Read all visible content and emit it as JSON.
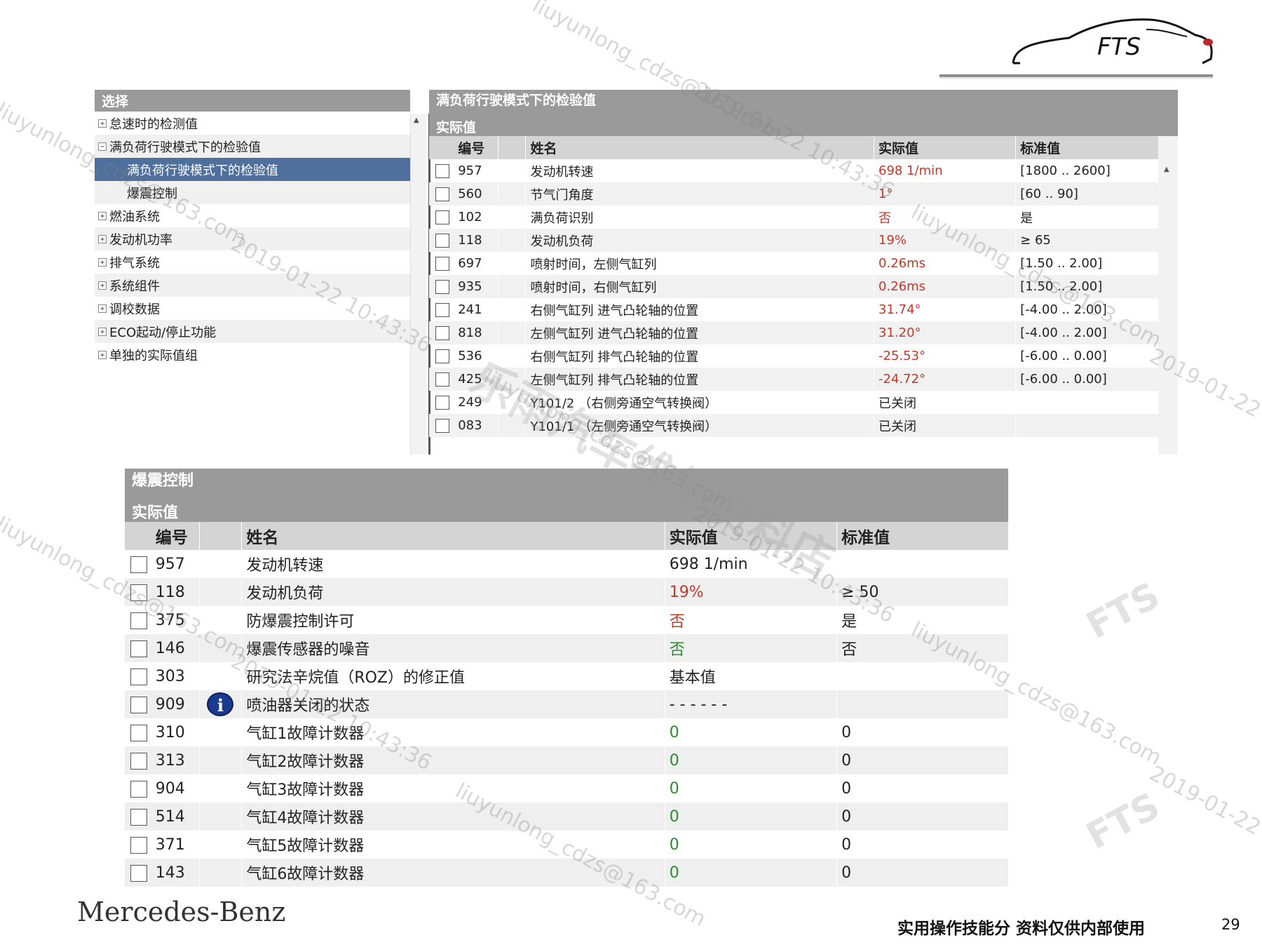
{
  "logo": {
    "text": "FTS"
  },
  "tree": {
    "header": "选择",
    "items": [
      {
        "label": "怠速时的检测值",
        "expander": "+",
        "level": 0,
        "selected": false
      },
      {
        "label": "满负荷行驶模式下的检验值",
        "expander": "−",
        "level": 0,
        "selected": false
      },
      {
        "label": "满负荷行驶模式下的检验值",
        "expander": "",
        "level": 1,
        "selected": true
      },
      {
        "label": "爆震控制",
        "expander": "",
        "level": 1,
        "selected": false
      },
      {
        "label": "燃油系统",
        "expander": "+",
        "level": 0,
        "selected": false
      },
      {
        "label": "发动机功率",
        "expander": "+",
        "level": 0,
        "selected": false
      },
      {
        "label": "排气系统",
        "expander": "+",
        "level": 0,
        "selected": false
      },
      {
        "label": "系统组件",
        "expander": "+",
        "level": 0,
        "selected": false
      },
      {
        "label": "调校数据",
        "expander": "+",
        "level": 0,
        "selected": false
      },
      {
        "label": "ECO起动/停止功能",
        "expander": "+",
        "level": 0,
        "selected": false
      },
      {
        "label": "单独的实际值组",
        "expander": "+",
        "level": 0,
        "selected": false
      }
    ]
  },
  "full_load": {
    "title": "满负荷行驶模式下的检验值",
    "subtitle": "实际值",
    "columns": {
      "num": "编号",
      "name": "姓名",
      "value": "实际值",
      "standard": "标准值"
    },
    "rows": [
      {
        "num": "957",
        "name": "发动机转速",
        "value": "698 1/min",
        "value_color": "red",
        "standard": "[1800 .. 2600]"
      },
      {
        "num": "560",
        "name": "节气门角度",
        "value": "1°",
        "value_color": "red",
        "standard": "[60 .. 90]"
      },
      {
        "num": "102",
        "name": "满负荷识别",
        "value": "否",
        "value_color": "red",
        "standard": "是"
      },
      {
        "num": "118",
        "name": "发动机负荷",
        "value": "19%",
        "value_color": "red",
        "standard": "≥ 65"
      },
      {
        "num": "697",
        "name": "喷射时间，左侧气缸列",
        "value": "0.26ms",
        "value_color": "red",
        "standard": "[1.50 .. 2.00]"
      },
      {
        "num": "935",
        "name": "喷射时间，右侧气缸列",
        "value": "0.26ms",
        "value_color": "red",
        "standard": "[1.50 .. 2.00]"
      },
      {
        "num": "241",
        "name": "右侧气缸列 进气凸轮轴的位置",
        "value": "31.74°",
        "value_color": "red",
        "standard": "[-4.00 .. 2.00]"
      },
      {
        "num": "818",
        "name": "左侧气缸列 进气凸轮轴的位置",
        "value": "31.20°",
        "value_color": "red",
        "standard": "[-4.00 .. 2.00]"
      },
      {
        "num": "536",
        "name": "右侧气缸列 排气凸轮轴的位置",
        "value": "-25.53°",
        "value_color": "red",
        "standard": "[-6.00 .. 0.00]"
      },
      {
        "num": "425",
        "name": "左侧气缸列 排气凸轮轴的位置",
        "value": "-24.72°",
        "value_color": "red",
        "standard": "[-6.00 .. 0.00]"
      },
      {
        "num": "249",
        "name": "Y101/2 （右侧旁通空气转换阀）",
        "value": "已关闭",
        "value_color": "normal",
        "standard": ""
      },
      {
        "num": "083",
        "name": "Y101/1 （左侧旁通空气转换阀）",
        "value": "已关闭",
        "value_color": "normal",
        "standard": ""
      }
    ]
  },
  "knock": {
    "title": "爆震控制",
    "subtitle": "实际值",
    "columns": {
      "num": "编号",
      "name": "姓名",
      "value": "实际值",
      "standard": "标准值"
    },
    "rows": [
      {
        "num": "957",
        "icon": "",
        "name": "发动机转速",
        "value": "698 1/min",
        "value_color": "normal",
        "standard": ""
      },
      {
        "num": "118",
        "icon": "",
        "name": "发动机负荷",
        "value": "19%",
        "value_color": "red",
        "standard": "≥ 50"
      },
      {
        "num": "375",
        "icon": "",
        "name": "防爆震控制许可",
        "value": "否",
        "value_color": "red",
        "standard": "是"
      },
      {
        "num": "146",
        "icon": "",
        "name": "爆震传感器的噪音",
        "value": "否",
        "value_color": "green",
        "standard": "否"
      },
      {
        "num": "303",
        "icon": "",
        "name": "研究法辛烷值（ROZ）的修正值",
        "value": "基本值",
        "value_color": "normal",
        "standard": ""
      },
      {
        "num": "909",
        "icon": "info-icon",
        "name": "喷油器关闭的状态",
        "value": "- - - - - -",
        "value_color": "normal",
        "standard": ""
      },
      {
        "num": "310",
        "icon": "",
        "name": "气缸1故障计数器",
        "value": "0",
        "value_color": "green",
        "standard": "0"
      },
      {
        "num": "313",
        "icon": "",
        "name": "气缸2故障计数器",
        "value": "0",
        "value_color": "green",
        "standard": "0"
      },
      {
        "num": "904",
        "icon": "",
        "name": "气缸3故障计数器",
        "value": "0",
        "value_color": "green",
        "standard": "0"
      },
      {
        "num": "514",
        "icon": "",
        "name": "气缸4故障计数器",
        "value": "0",
        "value_color": "green",
        "standard": "0"
      },
      {
        "num": "371",
        "icon": "",
        "name": "气缸5故障计数器",
        "value": "0",
        "value_color": "green",
        "standard": "0"
      },
      {
        "num": "143",
        "icon": "",
        "name": "气缸6故障计数器",
        "value": "0",
        "value_color": "green",
        "standard": "0"
      }
    ]
  },
  "footer": {
    "brand": "Mercedes-Benz",
    "note": "实用操作技能分 资料仅供内部使用",
    "page": "29"
  },
  "watermarks": {
    "email": "liuyunlong_cdzs@163.com",
    "date": "2019-01-22 10:43:36",
    "shop": "乐雨汽车维修资料店",
    "logo": "FTS"
  },
  "colors": {
    "header_bg": "#9a9a9a",
    "selected_bg": "#4f6f9c",
    "alarm": "#c0392b",
    "ok": "#2e8b2e"
  }
}
